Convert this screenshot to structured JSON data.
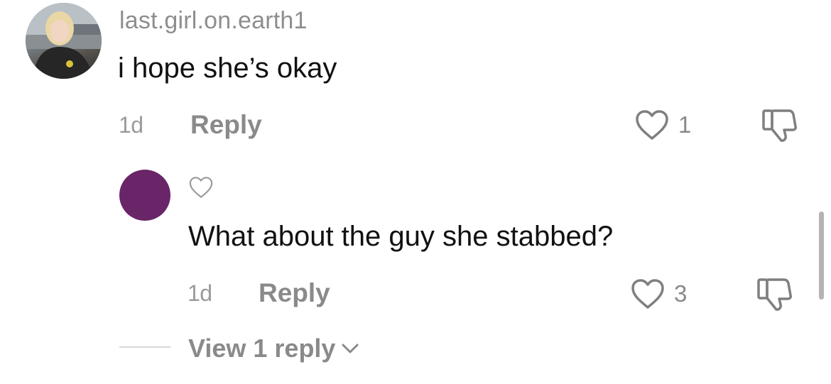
{
  "comment": {
    "username": "last.girl.on.earth1",
    "text": "i hope she’s okay",
    "time": "1d",
    "reply_label": "Reply",
    "like_count": "1"
  },
  "reply": {
    "text": "What about the guy she stabbed?",
    "time": "1d",
    "reply_label": "Reply",
    "like_count": "3"
  },
  "view_replies_label": "View 1 reply",
  "icons": {
    "like": "heart-outline-icon",
    "dislike": "thumbs-down-icon",
    "expand": "chevron-down-icon"
  },
  "colors": {
    "reply_avatar": "#6a2569",
    "muted_text": "#8a8a8a"
  }
}
